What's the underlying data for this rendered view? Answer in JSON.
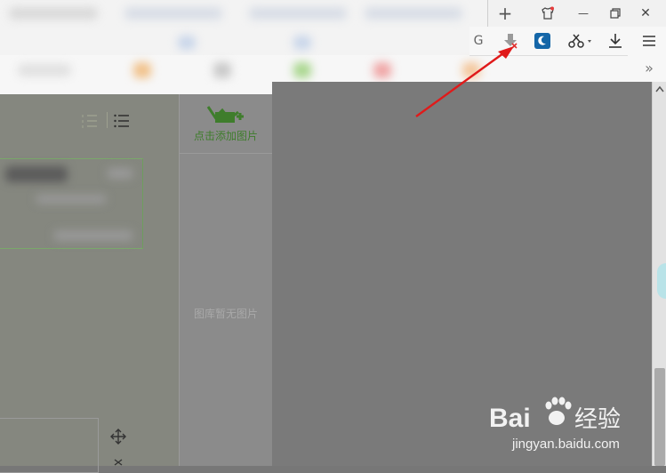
{
  "browser": {
    "tabbar_buttons": [
      {
        "name": "new-tab-button",
        "glyph": "+"
      },
      {
        "name": "skin-button",
        "icon": "shirt-icon"
      },
      {
        "name": "minimize-button",
        "glyph": "—"
      },
      {
        "name": "restore-button",
        "icon": "restore-icon"
      },
      {
        "name": "close-window-button",
        "glyph": "✕"
      }
    ],
    "toolbar_icons": [
      "download-extension-icon",
      "night-mode-icon",
      "scissors-icon",
      "download-icon",
      "menu-icon"
    ],
    "overflow_glyph": "»"
  },
  "gallery": {
    "add_image_label": "点击添加图片",
    "empty_label": "图库暂无图片"
  },
  "colors": {
    "accent_green": "#3f7d2c",
    "arrow_red": "#e01a1a",
    "night_mode_blue": "#1466a8"
  }
}
